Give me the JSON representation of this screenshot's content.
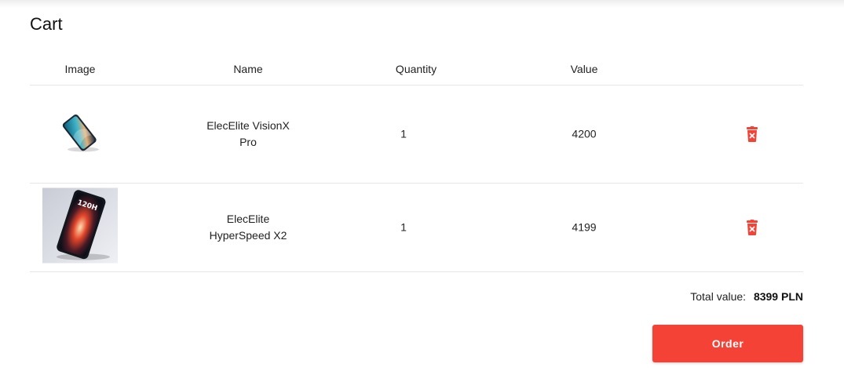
{
  "page": {
    "title": "Cart"
  },
  "table": {
    "columns": [
      "Image",
      "Name",
      "Quantity",
      "Value"
    ],
    "rows": [
      {
        "name": "ElecElite VisionX Pro",
        "quantity": "1",
        "value": "4200",
        "image_icon": "phone-image"
      },
      {
        "name": "ElecElite HyperSpeed X2",
        "quantity": "1",
        "value": "4199",
        "image_icon": "phone-image"
      }
    ]
  },
  "summary": {
    "total_label": "Total value:",
    "total_amount": "8399 PLN"
  },
  "actions": {
    "order_label": "Order",
    "delete_icon": "trash-icon"
  },
  "colors": {
    "accent": "#f44336",
    "divider": "#e6e6e6"
  }
}
